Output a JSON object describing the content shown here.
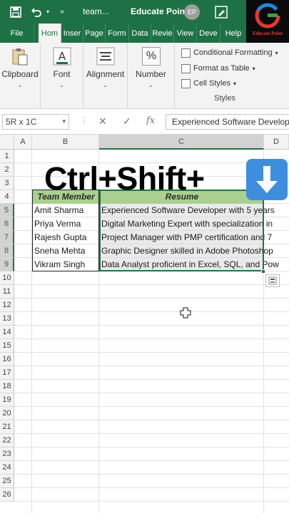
{
  "titlebar": {
    "file_name": "team...",
    "app_name": "Educate Point",
    "avatar_initials": "EP"
  },
  "brand": {
    "label": "Educate Point"
  },
  "tabs": [
    "File",
    "Hom",
    "Inser",
    "Page",
    "Form",
    "Data",
    "Revie",
    "View",
    "Deve",
    "Help"
  ],
  "ribbon": {
    "clipboard": "Clipboard",
    "font": "Font",
    "alignment": "Alignment",
    "number": "Number",
    "number_symbol": "%",
    "conditional_formatting": "Conditional Formatting",
    "format_as_table": "Format as Table",
    "cell_styles": "Cell Styles",
    "styles": "Styles"
  },
  "formula_bar": {
    "name_box": "5R x 1C",
    "fx": "fx",
    "content": "Experienced Software Developer with 5 years"
  },
  "columns": [
    "A",
    "B",
    "C",
    "D"
  ],
  "rows": [
    "1",
    "2",
    "3",
    "4",
    "5",
    "6",
    "7",
    "8",
    "9",
    "10",
    "11",
    "12",
    "13",
    "14",
    "15",
    "16",
    "17",
    "18",
    "19",
    "20",
    "21",
    "22",
    "23",
    "24",
    "25",
    "26"
  ],
  "table": {
    "headers": [
      "Team Member",
      "Resume"
    ],
    "rows": [
      [
        "Amit Sharma",
        "Experienced Software Developer with 5 years"
      ],
      [
        "Priya Verma",
        "Digital Marketing Expert with specialization in"
      ],
      [
        "Rajesh Gupta",
        "Project Manager with PMP certification and 7"
      ],
      [
        "Sneha Mehta",
        "Graphic Designer skilled in Adobe Photoshop"
      ],
      [
        "Vikram Singh",
        "Data Analyst proficient in Excel, SQL, and Pow"
      ]
    ]
  },
  "overlay": {
    "text": "Ctrl+Shift+"
  },
  "colors": {
    "excel_green": "#1e7145",
    "header_fill": "#a9d08e",
    "arrow_key": "#3e8ede"
  }
}
